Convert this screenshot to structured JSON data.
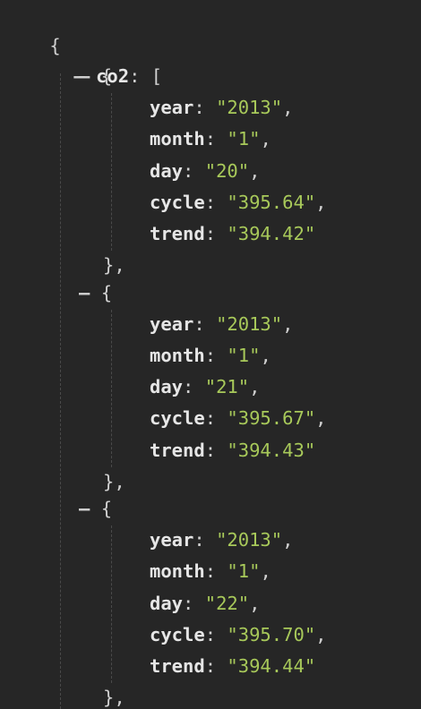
{
  "json": {
    "open_brace": "{",
    "root_key": "co2",
    "array_open": "[",
    "collapse_glyph": "–",
    "object_open": "{",
    "object_close": "},",
    "records": [
      {
        "year": "2013",
        "month": "1",
        "day": "20",
        "cycle": "395.64",
        "trend": "394.42"
      },
      {
        "year": "2013",
        "month": "1",
        "day": "21",
        "cycle": "395.67",
        "trend": "394.43"
      },
      {
        "year": "2013",
        "month": "1",
        "day": "22",
        "cycle": "395.70",
        "trend": "394.44"
      }
    ],
    "field_keys": [
      "year",
      "month",
      "day",
      "cycle",
      "trend"
    ]
  }
}
